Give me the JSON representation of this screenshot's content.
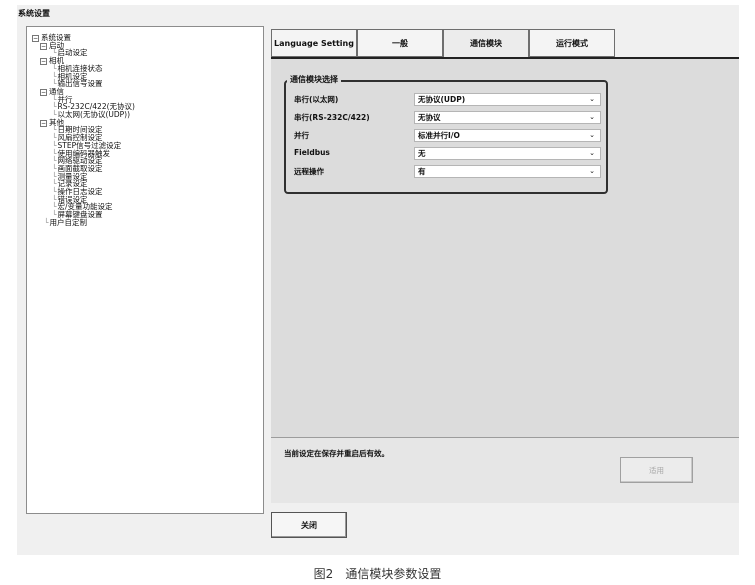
{
  "window": {
    "title": "系统设置"
  },
  "tree": [
    {
      "label": "系统设置",
      "toggle": "⊟",
      "level": 0
    },
    {
      "label": "启动",
      "toggle": "⊟",
      "level": 1
    },
    {
      "label": "启动设定",
      "level": 2
    },
    {
      "label": "相机",
      "toggle": "⊟",
      "level": 1
    },
    {
      "label": "相机连接状态",
      "level": 2
    },
    {
      "label": "相机设定",
      "level": 2
    },
    {
      "label": "输出信号设置",
      "level": 2
    },
    {
      "label": "通信",
      "toggle": "⊟",
      "level": 1
    },
    {
      "label": "并行",
      "level": 2
    },
    {
      "label": "RS-232C/422(无协议)",
      "level": 2
    },
    {
      "label": "以太网(无协议(UDP))",
      "level": 2
    },
    {
      "label": "其他",
      "toggle": "⊟",
      "level": 1
    },
    {
      "label": "日期时间设定",
      "level": 2
    },
    {
      "label": "风扇控制设定",
      "level": 2
    },
    {
      "label": "STEP信号过滤设定",
      "level": 2
    },
    {
      "label": "使用编码器触发",
      "level": 2
    },
    {
      "label": "网络驱动设定",
      "level": 2
    },
    {
      "label": "画面截取设定",
      "level": 2
    },
    {
      "label": "测量设定",
      "level": 2
    },
    {
      "label": "记录设定",
      "level": 2
    },
    {
      "label": "操作日志设定",
      "level": 2
    },
    {
      "label": "错误设定",
      "level": 2
    },
    {
      "label": "宏/变量功能设定",
      "level": 2
    },
    {
      "label": "屏幕键盘设置",
      "level": 2
    },
    {
      "label": "用户自定制",
      "level": 1
    }
  ],
  "tabs": [
    {
      "label": "Language Setting",
      "active": false
    },
    {
      "label": "一般",
      "active": false
    },
    {
      "label": "通信模块",
      "active": true
    },
    {
      "label": "运行模式",
      "active": false
    }
  ],
  "group": {
    "title": "通信模块选择",
    "rows": [
      {
        "label": "串行(以太网)",
        "value": "无协议(UDP)"
      },
      {
        "label": "串行(RS-232C/422)",
        "value": "无协议"
      },
      {
        "label": "并行",
        "value": "标准并行I/O"
      },
      {
        "label": "Fieldbus",
        "value": "无"
      },
      {
        "label": "远程操作",
        "value": "有"
      }
    ]
  },
  "note": "当前设定在保存并重启后有效。",
  "buttons": {
    "apply": "适用",
    "close": "关闭"
  },
  "caption": {
    "figure": "图2",
    "text": "通信模块参数设置"
  },
  "icons": {
    "dropdown": "chevron-down-icon",
    "expand": "tree-collapse-icon"
  }
}
